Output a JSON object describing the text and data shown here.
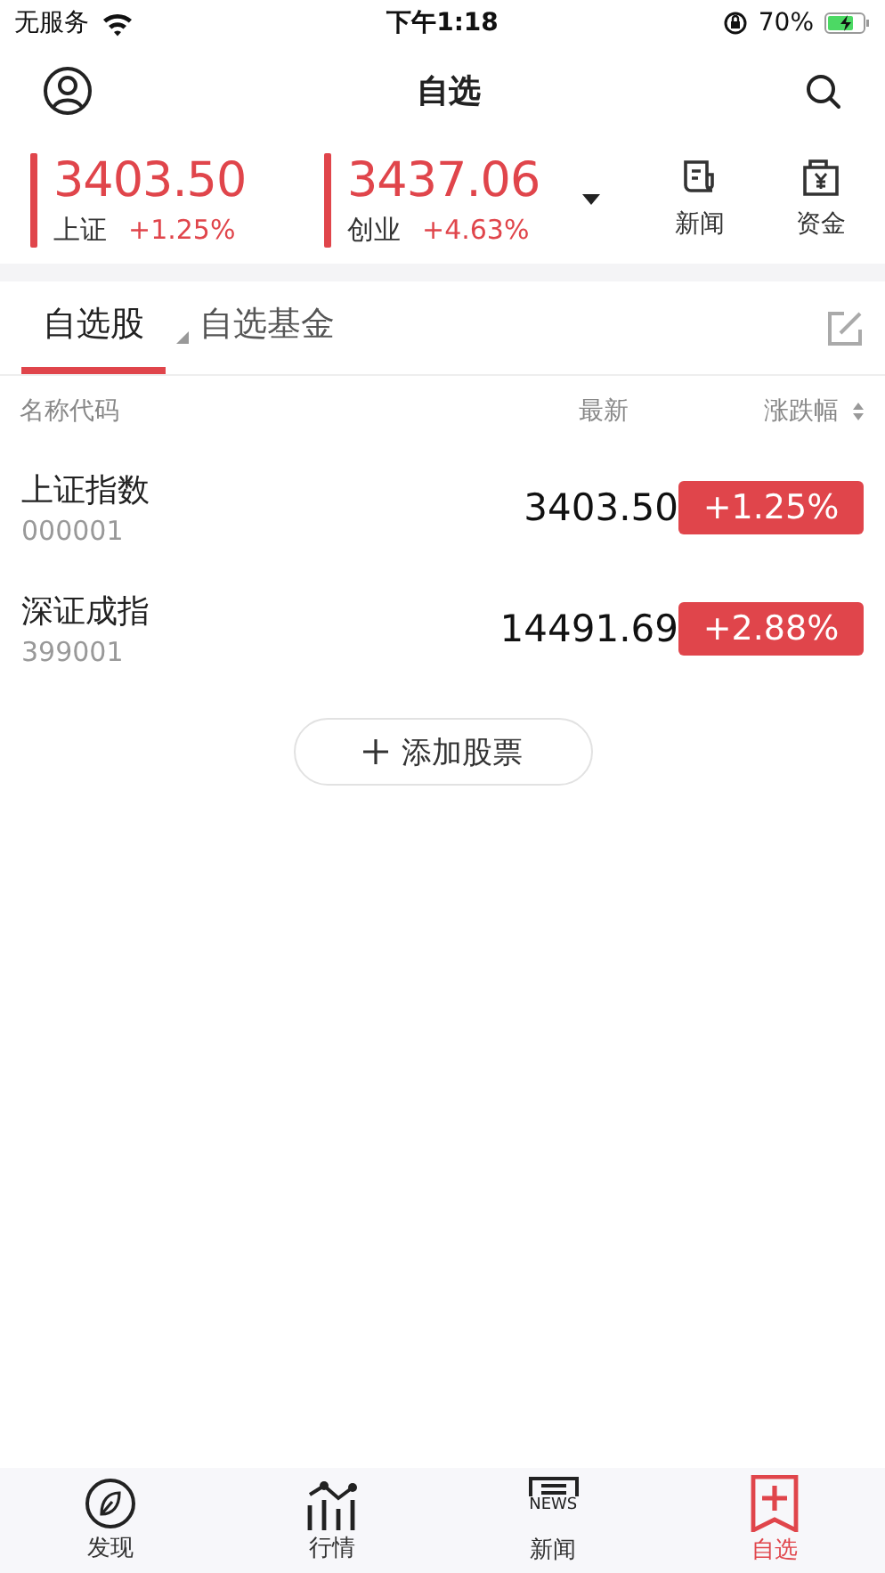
{
  "status_bar": {
    "carrier": "无服务",
    "time": "下午1:18",
    "battery": "70%"
  },
  "header": {
    "title": "自选"
  },
  "indices": [
    {
      "value": "3403.50",
      "name": "上证",
      "change": "+1.25%"
    },
    {
      "value": "3437.06",
      "name": "创业",
      "change": "+4.63%"
    }
  ],
  "shortcuts": [
    {
      "label": "新闻"
    },
    {
      "label": "资金"
    }
  ],
  "tabs": [
    {
      "label": "自选股",
      "selected": true
    },
    {
      "label": "自选基金",
      "selected": false
    }
  ],
  "columns": [
    "名称代码",
    "最新",
    "涨跌幅"
  ],
  "rows": [
    {
      "name": "上证指数",
      "code": "000001",
      "price": "3403.50",
      "change": "+1.25%"
    },
    {
      "name": "深证成指",
      "code": "399001",
      "price": "14491.69",
      "change": "+2.88%"
    }
  ],
  "add_button": {
    "label": "添加股票"
  },
  "tab_bar": [
    {
      "label": "发现",
      "selected": false
    },
    {
      "label": "行情",
      "selected": false
    },
    {
      "label": "新闻",
      "icon_text": "NEWS",
      "selected": false
    },
    {
      "label": "自选",
      "selected": true
    }
  ]
}
